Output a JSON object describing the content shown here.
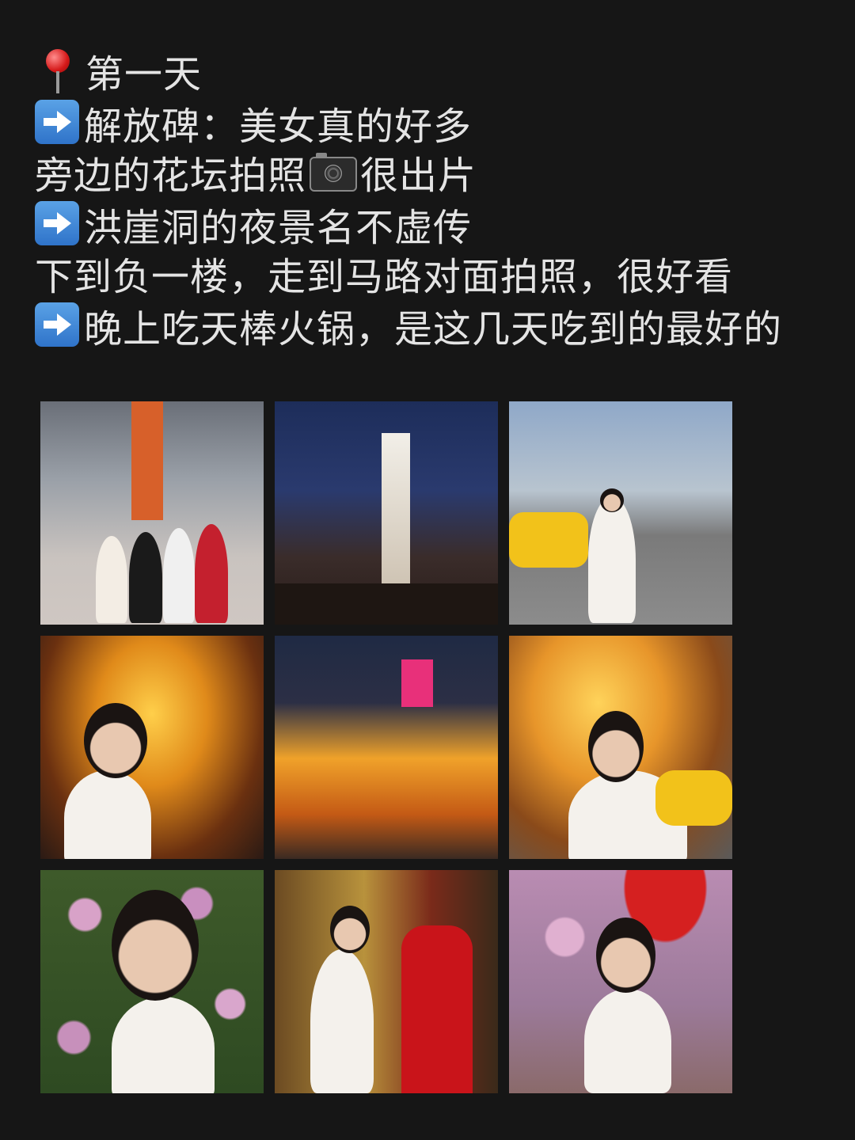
{
  "post": {
    "lines": [
      {
        "icon": "pin-icon",
        "text": "第一天"
      },
      {
        "icon": "arrow-right-icon",
        "text": "解放碑：美女真的好多"
      },
      {
        "icon": "",
        "text_before": "旁边的花坛拍照",
        "icon_inline": "camera-icon",
        "text_after": "很出片"
      },
      {
        "icon": "arrow-right-icon",
        "text": "洪崖洞的夜景名不虚传"
      },
      {
        "icon": "",
        "text": "下到负一楼，走到马路对面拍照，很好看"
      },
      {
        "icon": "arrow-right-icon",
        "text": "晚上吃天棒火锅，是这几天吃到的最好的"
      }
    ]
  },
  "gallery": {
    "photos": [
      {
        "subject": "group-photo-jiefangbei"
      },
      {
        "subject": "jiefangbei-monument-night"
      },
      {
        "subject": "street-taxi-day"
      },
      {
        "subject": "hongyadong-portrait-1"
      },
      {
        "subject": "hongyadong-night-view"
      },
      {
        "subject": "hongyadong-portrait-2"
      },
      {
        "subject": "flower-bed-portrait-1"
      },
      {
        "subject": "red-postbox-portrait"
      },
      {
        "subject": "flower-bed-portrait-2"
      }
    ]
  }
}
